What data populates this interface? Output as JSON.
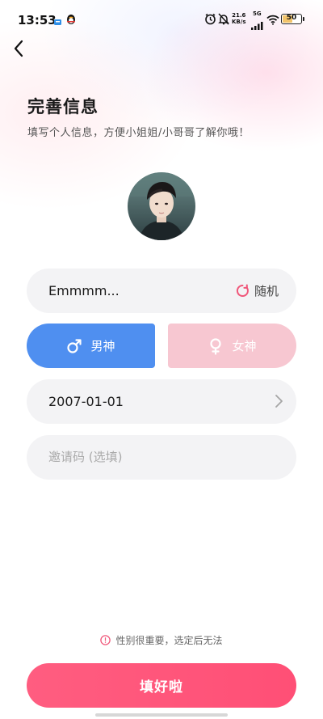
{
  "status_bar": {
    "time": "13:53",
    "net_speed_value": "21.6",
    "net_speed_unit": "KB/s",
    "network": "5G",
    "battery": "50"
  },
  "header": {
    "title": "完善信息",
    "subtitle": "填写个人信息，方便小姐姐/小哥哥了解你哦！"
  },
  "form": {
    "nickname": "Emmmm...",
    "random_label": "随机",
    "gender_male_label": "男神",
    "gender_female_label": "女神",
    "selected_gender": "male",
    "birthday": "2007-01-01",
    "invite_placeholder": "邀请码 (选填)"
  },
  "footer": {
    "hint": "性别很重要，选定后无法",
    "submit_label": "填好啦"
  },
  "colors": {
    "accent_pink": "#ff5d80",
    "male_blue": "#4f8ff0",
    "female_pink": "#f7c7d1"
  }
}
